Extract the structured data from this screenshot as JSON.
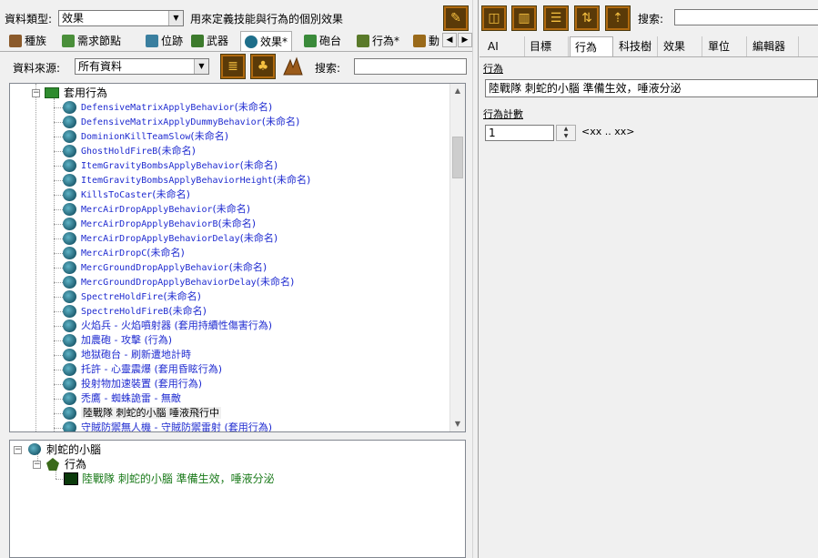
{
  "left": {
    "datatype_label": "資料類型:",
    "datatype_value": "效果",
    "datatype_desc": "用來定義技能與行為的個別效果",
    "tabs": [
      {
        "label": "種族",
        "color": "#8b5a2b"
      },
      {
        "label": "需求節點",
        "color": "#4a8f3a"
      },
      {
        "label": "位跡",
        "color": "#3a7f9f"
      },
      {
        "label": "武器",
        "color": "#3c7a2c"
      },
      {
        "label": "效果*",
        "color": "#1f6f8b"
      },
      {
        "label": "砲台",
        "color": "#3a8a3a"
      },
      {
        "label": "行為*",
        "color": "#5a7a2a"
      },
      {
        "label": "動",
        "color": "#9a6a1a"
      }
    ],
    "source_label": "資料來源:",
    "source_value": "所有資料",
    "search_label": "搜索:",
    "search_value": "",
    "tree": {
      "group_label": "套用行為",
      "items": [
        {
          "label": "DefensiveMatrixApplyBehavior",
          "suffix": "(未命名)",
          "mono": true
        },
        {
          "label": "DefensiveMatrixApplyDummyBehavior",
          "suffix": "(未命名)",
          "mono": true
        },
        {
          "label": "DominionKillTeamSlow",
          "suffix": "(未命名)",
          "mono": true
        },
        {
          "label": "GhostHoldFireB",
          "suffix": "(未命名)",
          "mono": true
        },
        {
          "label": "ItemGravityBombsApplyBehavior",
          "suffix": "(未命名)",
          "mono": true
        },
        {
          "label": "ItemGravityBombsApplyBehaviorHeight",
          "suffix": "(未命名)",
          "mono": true
        },
        {
          "label": "KillsToCaster",
          "suffix": "(未命名)",
          "mono": true
        },
        {
          "label": "MercAirDropApplyBehavior",
          "suffix": "(未命名)",
          "mono": true
        },
        {
          "label": "MercAirDropApplyBehaviorB",
          "suffix": "(未命名)",
          "mono": true
        },
        {
          "label": "MercAirDropApplyBehaviorDelay",
          "suffix": "(未命名)",
          "mono": true
        },
        {
          "label": "MercAirDropC",
          "suffix": "(未命名)",
          "mono": true
        },
        {
          "label": "MercGroundDropApplyBehavior",
          "suffix": "(未命名)",
          "mono": true
        },
        {
          "label": "MercGroundDropApplyBehaviorDelay",
          "suffix": "(未命名)",
          "mono": true
        },
        {
          "label": "SpectreHoldFire",
          "suffix": "(未命名)",
          "mono": true
        },
        {
          "label": "SpectreHoldFireB",
          "suffix": "(未命名)",
          "mono": true
        },
        {
          "label": "火焰兵 - 火焰噴射器 (套用持續性傷害行為)",
          "suffix": "",
          "mono": false
        },
        {
          "label": "加農砲 - 攻擊 (行為)",
          "suffix": "",
          "mono": false
        },
        {
          "label": "地獄砲台 - 刷新遭地計時",
          "suffix": "",
          "mono": false
        },
        {
          "label": "托許 - 心靈震爆 (套用昏眩行為)",
          "suffix": "",
          "mono": false
        },
        {
          "label": "投射物加速裝置 (套用行為)",
          "suffix": "",
          "mono": false
        },
        {
          "label": "禿鷹 - 蜘蛛詭雷 - 無敵",
          "suffix": "",
          "mono": false
        },
        {
          "label": "陸戰隊 刺蛇的小腦 唾液飛行中",
          "suffix": "",
          "mono": false,
          "selected": true
        },
        {
          "label": "守賊防禦無人機 - 守賊防禦雷射 (套用行為)",
          "suffix": "",
          "mono": false
        }
      ]
    },
    "bottom_tree": {
      "root": "刺蛇的小腦",
      "child": "行為",
      "leaf": "陸戰隊 刺蛇的小腦 準備生效，唾液分泌"
    }
  },
  "right": {
    "search_label": "搜索:",
    "search_value": "",
    "tabs": [
      "AI",
      "目標",
      "行為",
      "科技樹",
      "效果",
      "單位",
      "編輯器"
    ],
    "active_tab": "行為",
    "field1_label": "行為",
    "field1_value": "陸戰隊 刺蛇的小腦 準備生效，唾液分泌",
    "field2_label": "行為計數",
    "field2_value": "1",
    "field2_range": "<xx .. xx>"
  },
  "colors": {
    "tree_text": "#1f2bd0",
    "toolbar_btn_bg": "#5a3a08",
    "toolbar_btn_border": "#b06a10"
  }
}
